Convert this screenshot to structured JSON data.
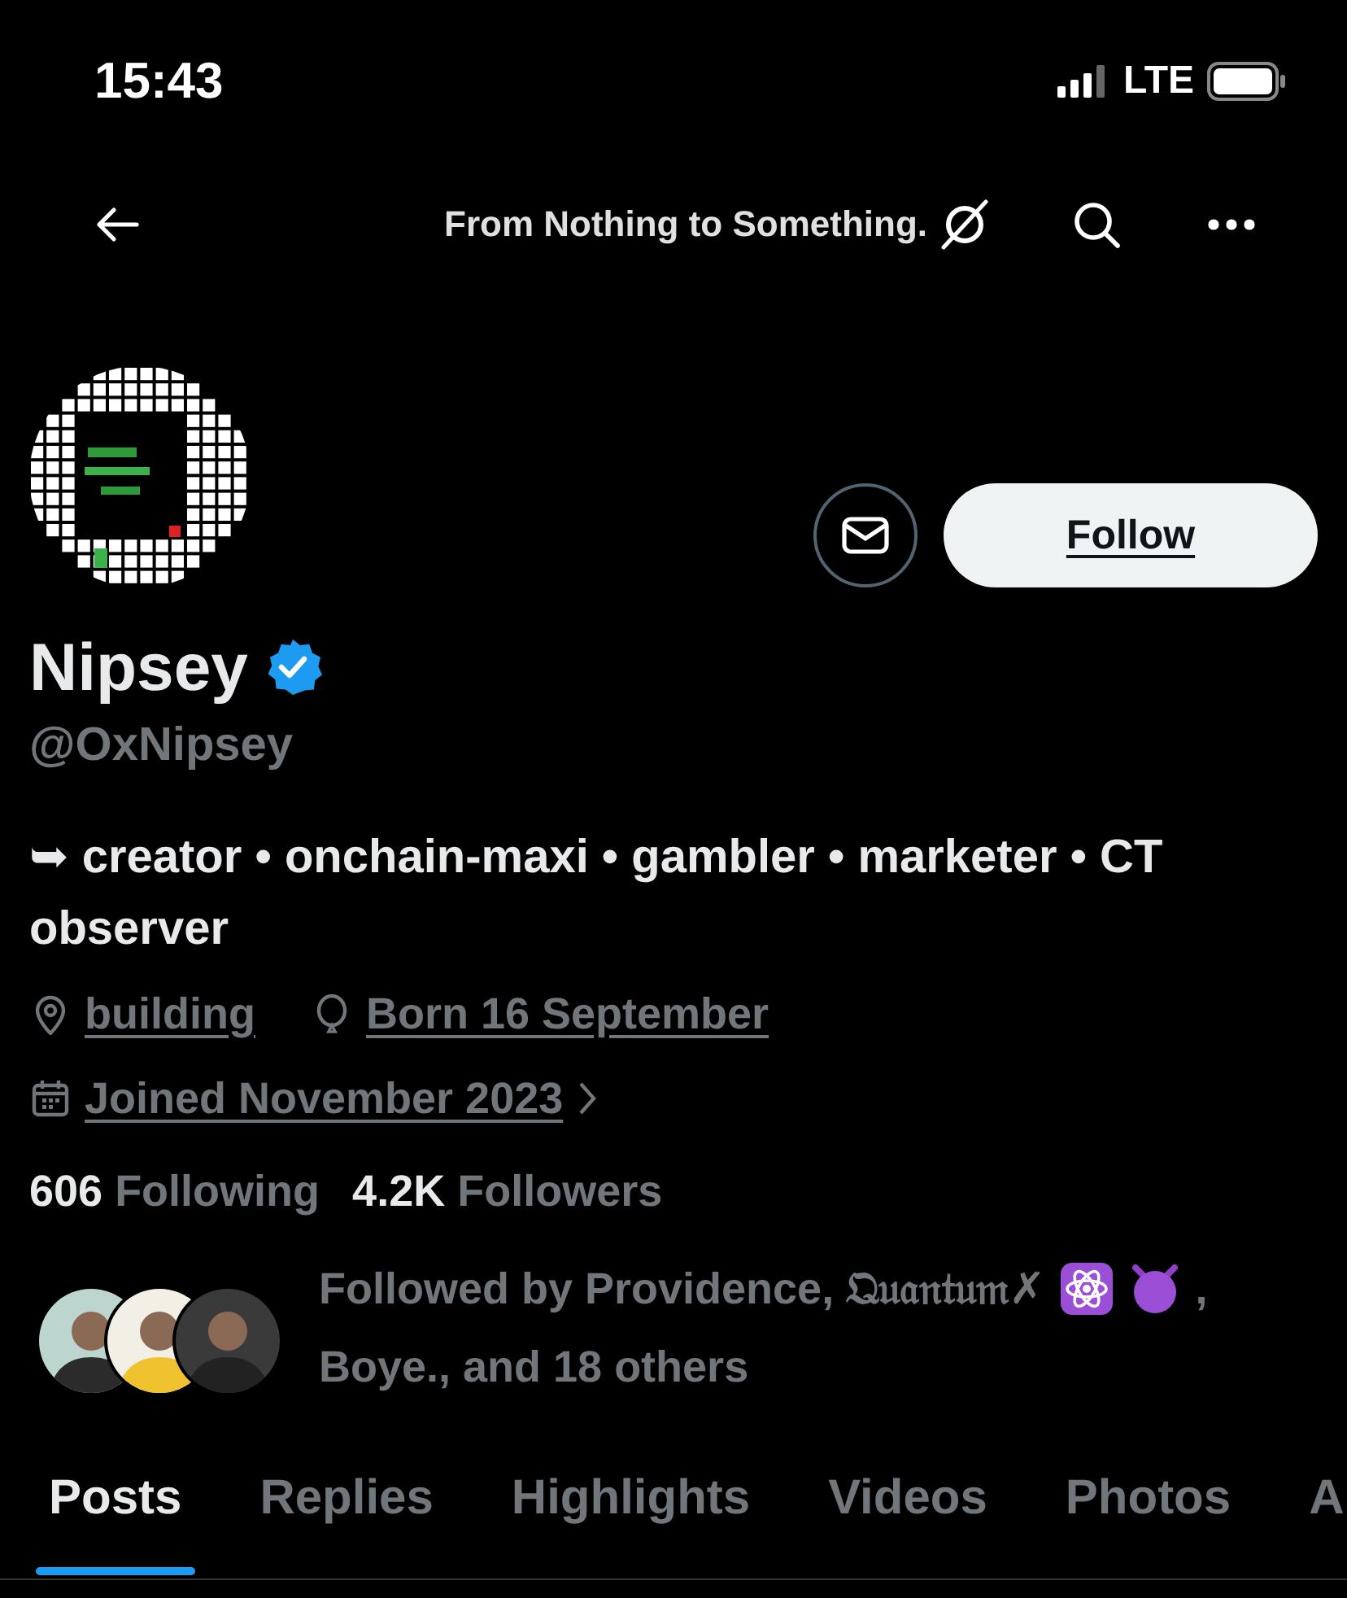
{
  "status_bar": {
    "time": "15:43",
    "network": "LTE"
  },
  "nav": {
    "banner_text": "From Nothing to Something."
  },
  "profile": {
    "name": "Nipsey",
    "verified": true,
    "handle": "@OxNipsey",
    "bio": "➥ creator • onchain-maxi • gambler • marketer • CT observer",
    "meta": [
      {
        "kind": "location",
        "text": "building"
      },
      {
        "kind": "birthday",
        "text": "Born 16 September"
      },
      {
        "kind": "joined",
        "text": "Joined November 2023",
        "chevron": true
      }
    ],
    "stats": [
      {
        "count": "606",
        "label": "Following"
      },
      {
        "count": "4.2K",
        "label": "Followers"
      }
    ],
    "followed_by": {
      "line_1": "Followed by Providence, 𝔔𝔲𝔞𝔫𝔱𝔲𝔪✗",
      "badges": [
        {
          "kind": "atom"
        },
        {
          "kind": "devil"
        }
      ],
      "line_1_end": ",",
      "line_2": "Boye., and 18 others"
    },
    "follow_button": "Follow"
  },
  "tabs": [
    {
      "label": "Posts",
      "selected": true
    },
    {
      "label": "Replies",
      "selected": false
    },
    {
      "label": "Highlights",
      "selected": false
    },
    {
      "label": "Videos",
      "selected": false
    },
    {
      "label": "Photos",
      "selected": false
    },
    {
      "label": "A",
      "selected": false
    }
  ]
}
